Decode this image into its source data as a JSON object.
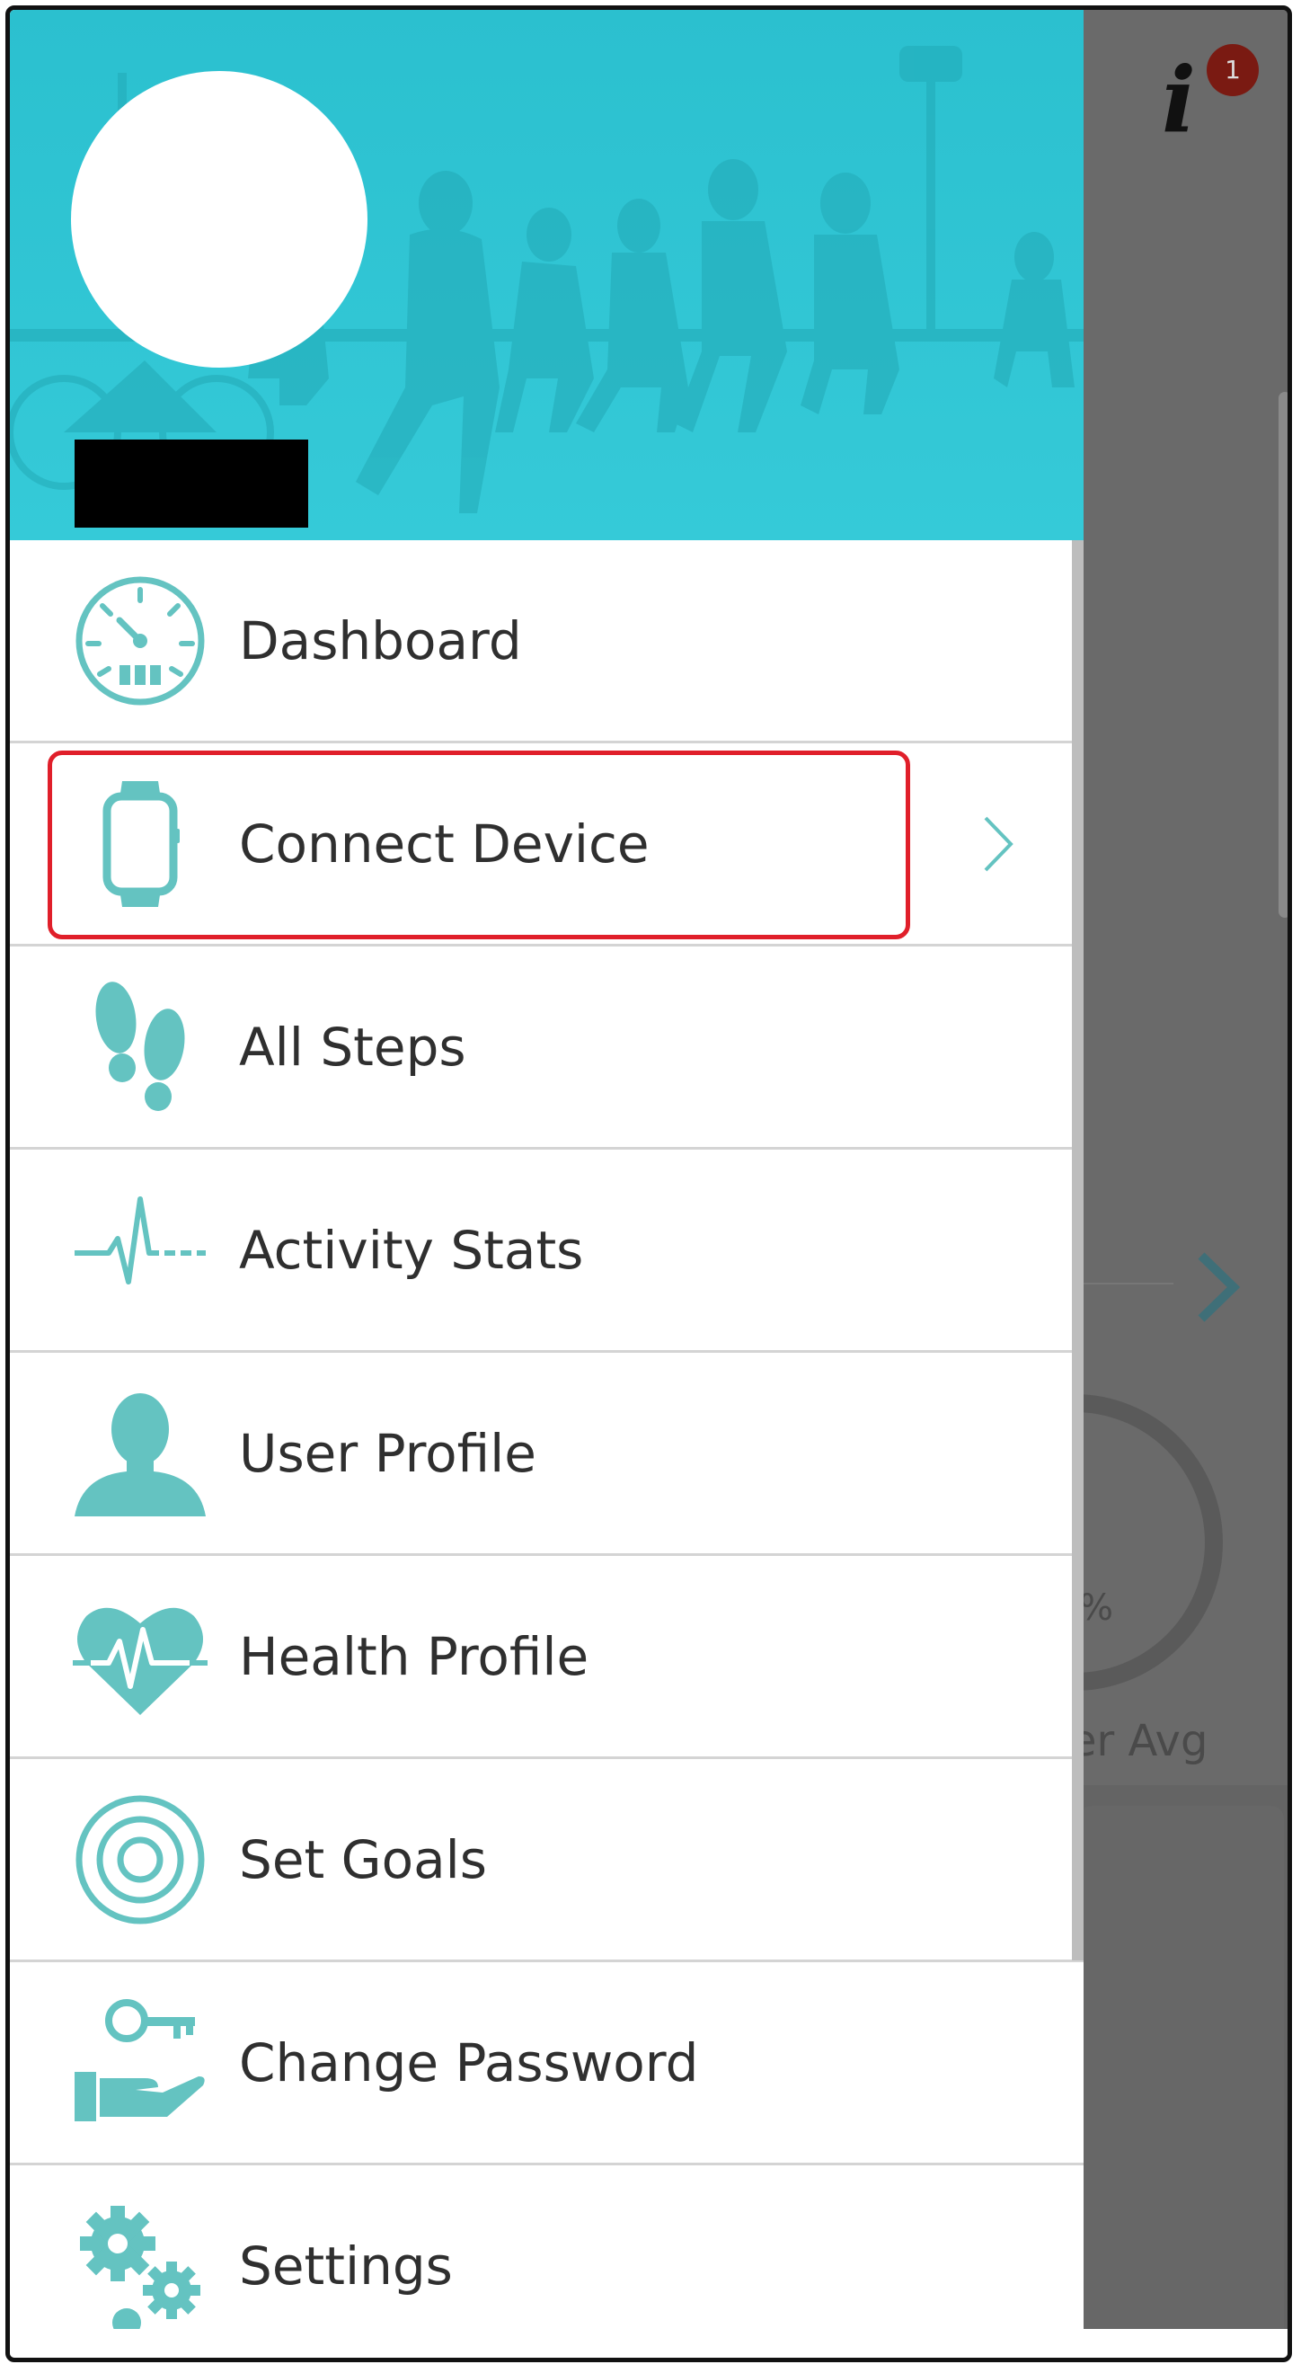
{
  "status": {
    "notification_count": "1",
    "info_icon": "info-icon"
  },
  "background": {
    "percent_fragment": "%",
    "avg_fragment": "er Avg"
  },
  "drawer": {
    "items": [
      {
        "label": "Dashboard",
        "icon": "speedometer-icon"
      },
      {
        "label": "Connect Device",
        "icon": "smartwatch-icon",
        "has_chevron": true,
        "highlighted": true
      },
      {
        "label": "All Steps",
        "icon": "footprints-icon"
      },
      {
        "label": "Activity Stats",
        "icon": "pulse-icon"
      },
      {
        "label": "User Profile",
        "icon": "user-icon"
      },
      {
        "label": "Health Profile",
        "icon": "heart-pulse-icon"
      },
      {
        "label": "Set Goals",
        "icon": "target-icon"
      },
      {
        "label": "Change Password",
        "icon": "key-hand-icon"
      },
      {
        "label": "Settings",
        "icon": "gears-icon"
      }
    ]
  },
  "colors": {
    "header": "#33c6d4",
    "accent_icon": "#64c3c1",
    "highlight_border": "#e01f2a",
    "overlay": "#6a6a6a"
  }
}
